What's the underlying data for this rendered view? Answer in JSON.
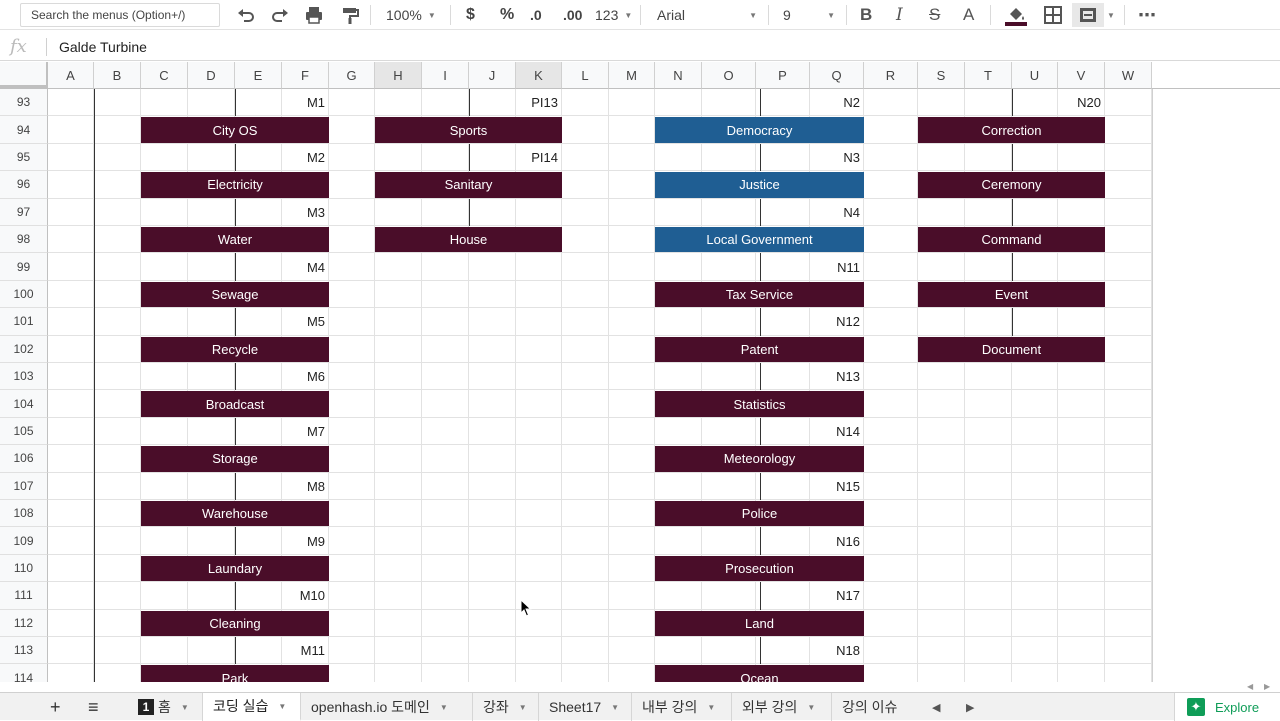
{
  "toolbar": {
    "search_placeholder": "Search the menus (Option+/)",
    "zoom": "100%",
    "currency": "$",
    "percent": "%",
    "dec_decrease": ".0",
    "dec_increase": ".00",
    "more_formats": "123",
    "font": "Arial",
    "font_size": "9",
    "bold": "B",
    "italic": "I",
    "strike": "S",
    "text_color": "A",
    "more": "⋯"
  },
  "formula_bar": {
    "fx": "fx",
    "value": "Galde Turbine"
  },
  "columns": [
    "A",
    "B",
    "C",
    "D",
    "E",
    "F",
    "G",
    "H",
    "I",
    "J",
    "K",
    "L",
    "M",
    "N",
    "O",
    "P",
    "Q",
    "R",
    "S",
    "T",
    "U",
    "V",
    "W"
  ],
  "rows": [
    "93",
    "94",
    "95",
    "96",
    "97",
    "98",
    "99",
    "100",
    "101",
    "102",
    "103",
    "104",
    "105",
    "106",
    "107",
    "108",
    "109",
    "110",
    "111",
    "112",
    "113",
    "114"
  ],
  "cells": {
    "m_labels": [
      "M1",
      "M2",
      "M3",
      "M4",
      "M5",
      "M6",
      "M7",
      "M8",
      "M9",
      "M10",
      "M11"
    ],
    "pi_labels": [
      "PI13",
      "PI14"
    ],
    "n_labels": [
      "N2",
      "N3",
      "N4",
      "N11",
      "N12",
      "N13",
      "N14",
      "N15",
      "N16",
      "N17",
      "N18"
    ],
    "n20": "N20"
  },
  "boxes": {
    "col_c": [
      "City OS",
      "Electricity",
      "Water",
      "Sewage",
      "Recycle",
      "Broadcast",
      "Storage",
      "Warehouse",
      "Laundary",
      "Cleaning",
      "Park"
    ],
    "col_h": [
      "Sports",
      "Sanitary",
      "House"
    ],
    "col_n_blue": [
      "Democracy",
      "Justice",
      "Local Government"
    ],
    "col_n": [
      "Tax Service",
      "Patent",
      "Statistics",
      "Meteorology",
      "Police",
      "Prosecution",
      "Land",
      "Ocean"
    ],
    "col_s": [
      "Correction",
      "Ceremony",
      "Command",
      "Event",
      "Document"
    ]
  },
  "colors": {
    "maroon": "#4a0d29",
    "blue": "#1f5e93",
    "explore_green": "#0f9d58"
  },
  "tabs": [
    {
      "label": "홈",
      "badge": "1"
    },
    {
      "label": "코딩 실습"
    },
    {
      "label": "openhash.io 도메인"
    },
    {
      "label": "강좌"
    },
    {
      "label": "Sheet17"
    },
    {
      "label": "내부 강의"
    },
    {
      "label": "외부 강의"
    },
    {
      "label": "강의 이슈"
    }
  ],
  "explore": "Explore",
  "add_sheet": "+",
  "all_sheets": "≡"
}
